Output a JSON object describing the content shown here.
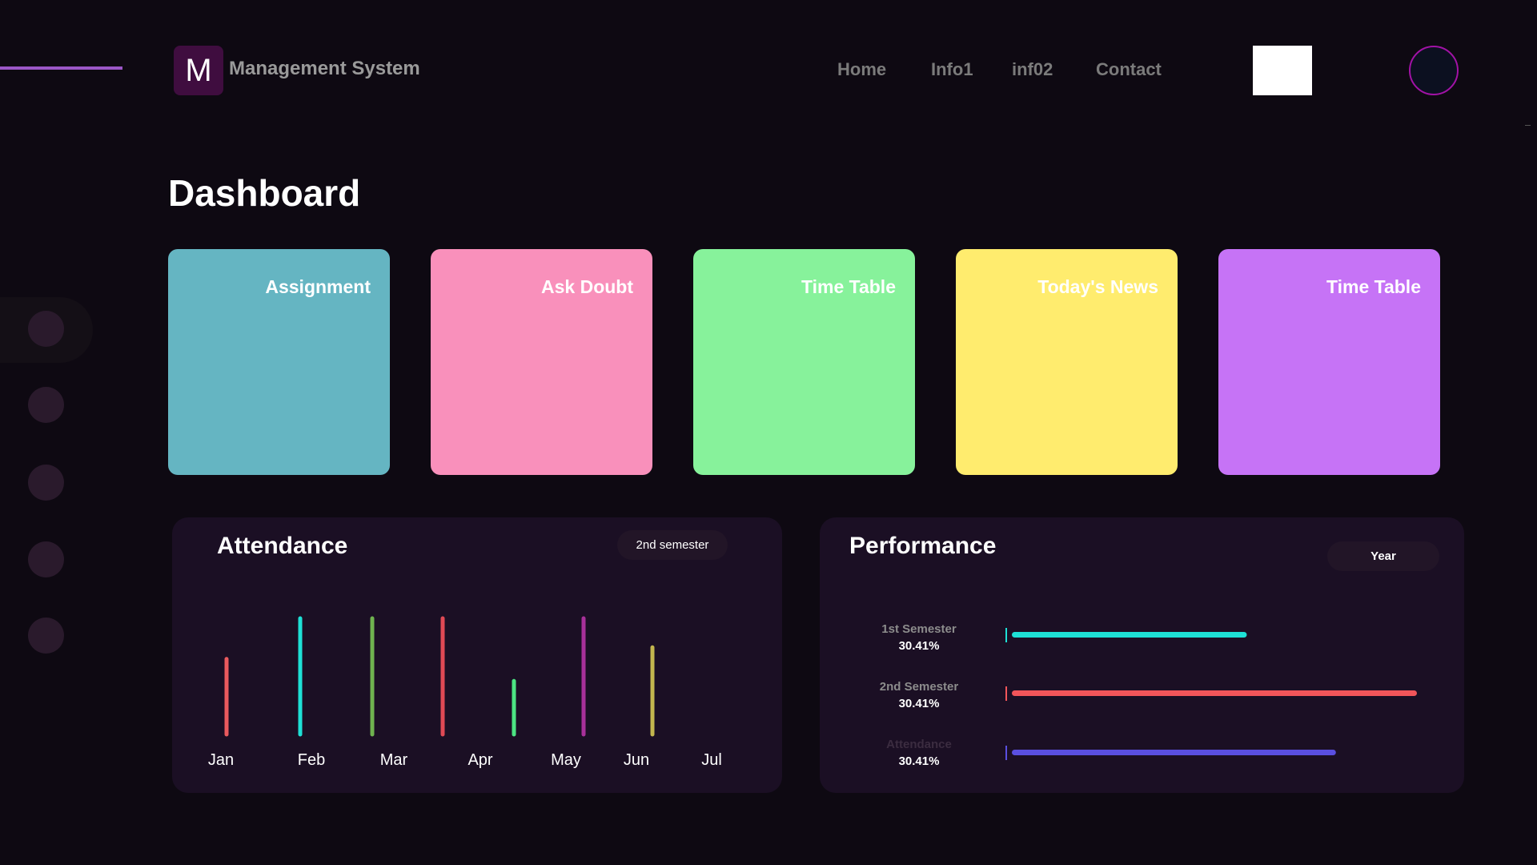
{
  "header": {
    "logo_letter": "M",
    "brand": "Management System",
    "nav": [
      "Home",
      "Info1",
      "inf02",
      "Contact"
    ]
  },
  "page_title": "Dashboard",
  "cards": [
    {
      "label": "Assignment",
      "color": "#65b5c2"
    },
    {
      "label": "Ask Doubt",
      "color": "#f990bb"
    },
    {
      "label": "Time Table",
      "color": "#87f29b"
    },
    {
      "label": "Today's News",
      "color": "#ffec6e"
    },
    {
      "label": "Time Table",
      "color": "#c673f6"
    }
  ],
  "attendance": {
    "title": "Attendance",
    "filter": "2nd semester",
    "chart_data": {
      "type": "bar",
      "categories": [
        "Jan",
        "Feb",
        "Mar",
        "Apr",
        "May",
        "Jun",
        "Jul"
      ],
      "values": [
        0.65,
        1.0,
        1.0,
        1.0,
        0.46,
        1.0,
        0.75
      ],
      "colors": [
        "#ea5a5e",
        "#1ee0d6",
        "#6fb24f",
        "#e04a55",
        "#4ce482",
        "#a8309a",
        "#c3b64e"
      ],
      "ylim": [
        0,
        1
      ]
    }
  },
  "performance": {
    "title": "Performance",
    "filter": "Year",
    "chart_data": {
      "type": "bar",
      "orientation": "horizontal",
      "categories": [
        "1st Semester",
        "2nd Semester",
        "Attendance"
      ],
      "value_labels": [
        "30.41%",
        "30.41%",
        "30.41%"
      ],
      "values": [
        0.58,
        1.0,
        0.8
      ],
      "colors": [
        "#1ee0d6",
        "#f2555a",
        "#5a4fe0"
      ],
      "label_colors": [
        "#8c8c8c",
        "#8c8c8c",
        "#3b2c40"
      ]
    }
  }
}
